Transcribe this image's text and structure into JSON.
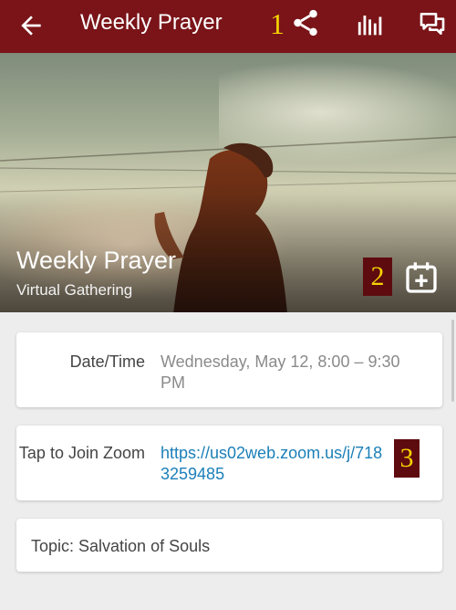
{
  "header": {
    "title": "Weekly Prayer",
    "annotation": "1",
    "icons": [
      "back-arrow-icon",
      "share-icon",
      "bar-chart-icon",
      "chat-icon"
    ],
    "background_color": "#7a1418"
  },
  "hero": {
    "title": "Weekly Prayer",
    "subtitle": "Virtual Gathering",
    "annotation": "2",
    "icons": [
      "add-to-calendar-icon"
    ]
  },
  "details": {
    "datetime_label": "Date/Time",
    "datetime_value": "Wednesday, May 12, 8:00 – 9:30 PM",
    "join_label": "Tap to Join Zoom",
    "join_link": "https://us02web.zoom.us/j/7183259485",
    "annotation": "3",
    "topic": "Topic: Salvation of Souls",
    "link_color": "#1b7fb8",
    "annotation_color": "#f5d300"
  }
}
